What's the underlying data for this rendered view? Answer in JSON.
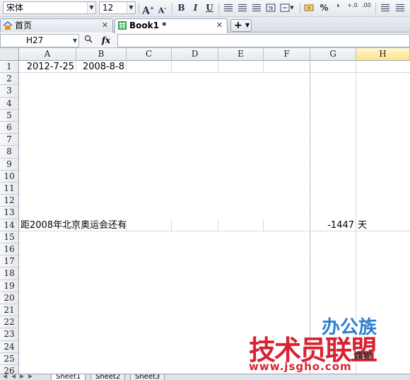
{
  "toolbar": {
    "font_name": "宋体",
    "font_size": "12",
    "grow_font": "A",
    "shrink_font": "A",
    "bold": "B",
    "italic": "I",
    "underline": "U",
    "percent": "%",
    "comma": "❜",
    "inc_decimal": "+.0",
    "dec_decimal": ".00"
  },
  "tabs": [
    {
      "label": "首页",
      "close": "✕"
    },
    {
      "label": "Book1 *",
      "close": "✕"
    }
  ],
  "new_tab": {
    "label": "+",
    "dropdown": "▼"
  },
  "formula_bar": {
    "cell_ref": "H27",
    "dropdown": "▼",
    "zoom_icon": "🔍",
    "fx": "fx",
    "value": ""
  },
  "columns": [
    "A",
    "B",
    "C",
    "D",
    "E",
    "F",
    "G",
    "H"
  ],
  "selected_column": "H",
  "rows": [
    "1",
    "2",
    "3",
    "4",
    "5",
    "6",
    "7",
    "8",
    "9",
    "10",
    "11",
    "12",
    "13",
    "14",
    "15",
    "16",
    "17",
    "18",
    "19",
    "20",
    "21",
    "22",
    "23",
    "24",
    "25",
    "26"
  ],
  "cells": {
    "A1": "2012-7-25",
    "B1": "2008-8-8",
    "A14": "距2008年北京奥运会还有",
    "G14": "-1447",
    "H14": "天"
  },
  "watermark": {
    "line1": "办公族",
    "line2": "技术员联盟",
    "line2_sub": "课程",
    "url": "www.jsgho.com"
  },
  "sheets": [
    "Sheet1",
    "Sheet2",
    "Sheet3"
  ],
  "active_sheet": "Sheet1",
  "colors": {
    "selected_col_header": "#ffe18a",
    "grid_line": "#d4d9e0",
    "watermark_red": "#d9222f",
    "watermark_blue": "#3a86d6"
  }
}
